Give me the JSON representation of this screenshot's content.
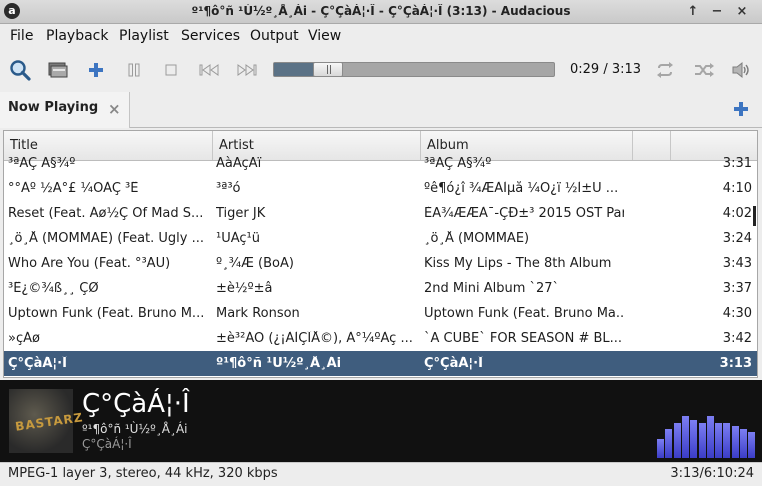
{
  "window": {
    "title": "º¹¶ô°ñ ¹Ù½º¸Å¸Ái - Ç°ÇàÁ¦·Î - Ç°ÇàÁ¦·Î (3:13) - Audacious"
  },
  "menu": [
    {
      "label": "File"
    },
    {
      "label": "Playback"
    },
    {
      "label": "Playlist"
    },
    {
      "label": "Services"
    },
    {
      "label": "Output"
    },
    {
      "label": "View"
    }
  ],
  "toolbar": {
    "icons": [
      "search-icon",
      "open-folder-icon",
      "add-icon",
      "pause-icon",
      "stop-icon",
      "previous-icon",
      "next-icon",
      "repeat-icon",
      "shuffle-icon",
      "volume-icon"
    ],
    "time": "0:29 / 3:13",
    "progress_fraction": 0.15
  },
  "tab": {
    "label": "Now Playing"
  },
  "playlist": {
    "columns": [
      "Title",
      "Artist",
      "Album",
      "",
      ""
    ],
    "rows": [
      {
        "title": "³ªÄÇ Ä§¾º",
        "artist": "ÄàÄçÄï",
        "album": "³ªÄÇ Ä§¾º",
        "length": "3:31"
      },
      {
        "title": "°°Àº ½Ã°£ ¼ÓÀÇ ³Ê",
        "artist": "³ª³ó",
        "album": "ºê¶ó¿î ¾ÆÀÌµå ¼Ò¿ï ½Ì±Û ...",
        "length": "4:10"
      },
      {
        "title": "Reset (Feat. Áø½Ç Of Mad S...",
        "artist": "Tiger JK",
        "album": "ÈÄ¾ÆÆÀ¯-ÇÐ±³ 2015 OST Par...",
        "length": "4:02"
      },
      {
        "title": "¸ö¸Å (MOMMAE) (Feat. Ugly ...",
        "artist": "¹ÚÀç¹ü",
        "album": "¸ö¸Å (MOMMAE)",
        "length": "3:24"
      },
      {
        "title": "Who Are You (Feat. °³ÄÚ)",
        "artist": "º¸¾Æ (BoA)",
        "album": "Kiss My Lips - The 8th Album",
        "length": "3:43"
      },
      {
        "title": "³Ê¿©¾ß¸¸ ÇØ",
        "artist": "±è½º±â",
        "album": "2nd Mini Album `27`",
        "length": "3:37"
      },
      {
        "title": "Uptown Funk (Feat. Bruno M...",
        "artist": "Mark Ronson",
        "album": "Uptown Funk (Feat. Bruno Ma...",
        "length": "4:30"
      },
      {
        "title": "»çÁø",
        "artist": "±è³²ÁÖ (¿¡ÀÌÇÎÅ©), À°¼ºÀç ...",
        "album": "`A CUBE` FOR SEASON # BL...",
        "length": "3:42"
      },
      {
        "title": "Ç°ÇàÁ¦·Î",
        "artist": "º¹¶ô°ñ ¹Ù½º¸Å¸Ái",
        "album": "Ç°ÇàÁ¦·Î",
        "length": "3:13",
        "selected": true
      }
    ]
  },
  "now_playing": {
    "art_text": "BASTARZ",
    "song": "Ç°ÇàÁ¦·Î",
    "artist": "º¹¶ô°ñ ¹Ù½º¸Å¸Ái",
    "album": "Ç°ÇàÁ¦·Î",
    "visualizer_levels": [
      0.3,
      0.45,
      0.55,
      0.65,
      0.6,
      0.55,
      0.65,
      0.55,
      0.55,
      0.5,
      0.45,
      0.4
    ]
  },
  "status": {
    "format": "MPEG-1 layer 3, stereo, 44 kHz, 320 kbps",
    "time": "3:13/6:10:24"
  },
  "colors": {
    "selection": "#3f5d7e",
    "seek_fill": "#5b7286",
    "visualizer": "#5a5cee"
  }
}
